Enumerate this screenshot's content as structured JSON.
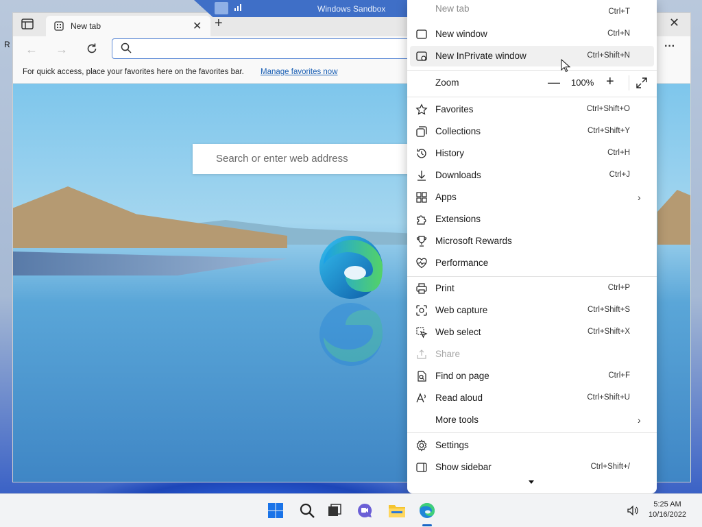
{
  "sandbox": {
    "title": "Windows Sandbox"
  },
  "desktop": {
    "stub": "R"
  },
  "browser": {
    "tab_label": "New tab",
    "favbar_message": "For quick access, place your favorites here on the favorites bar.",
    "favbar_link": "Manage favorites now",
    "page_search_placeholder": "Search or enter web address"
  },
  "menu": {
    "top_partial": {
      "label": "New tab",
      "shortcut": "Ctrl+T"
    },
    "items_a": [
      {
        "label": "New window",
        "shortcut": "Ctrl+N",
        "icon": "window-icon"
      },
      {
        "label": "New InPrivate window",
        "shortcut": "Ctrl+Shift+N",
        "icon": "inprivate-icon"
      }
    ],
    "zoom": {
      "label": "Zoom",
      "value": "100%"
    },
    "items_b": [
      {
        "label": "Favorites",
        "shortcut": "Ctrl+Shift+O",
        "icon": "star-icon"
      },
      {
        "label": "Collections",
        "shortcut": "Ctrl+Shift+Y",
        "icon": "collections-icon"
      },
      {
        "label": "History",
        "shortcut": "Ctrl+H",
        "icon": "history-icon"
      },
      {
        "label": "Downloads",
        "shortcut": "Ctrl+J",
        "icon": "download-icon"
      },
      {
        "label": "Apps",
        "shortcut": "",
        "icon": "apps-icon",
        "submenu": true
      },
      {
        "label": "Extensions",
        "shortcut": "",
        "icon": "puzzle-icon"
      },
      {
        "label": "Microsoft Rewards",
        "shortcut": "",
        "icon": "trophy-icon"
      },
      {
        "label": "Performance",
        "shortcut": "",
        "icon": "heartbeat-icon"
      }
    ],
    "items_c": [
      {
        "label": "Print",
        "shortcut": "Ctrl+P",
        "icon": "print-icon"
      },
      {
        "label": "Web capture",
        "shortcut": "Ctrl+Shift+S",
        "icon": "capture-icon"
      },
      {
        "label": "Web select",
        "shortcut": "Ctrl+Shift+X",
        "icon": "select-icon"
      },
      {
        "label": "Share",
        "shortcut": "",
        "icon": "share-icon",
        "disabled": true
      },
      {
        "label": "Find on page",
        "shortcut": "Ctrl+F",
        "icon": "find-icon"
      },
      {
        "label": "Read aloud",
        "shortcut": "Ctrl+Shift+U",
        "icon": "read-aloud-icon"
      },
      {
        "label": "More tools",
        "shortcut": "",
        "icon": "",
        "submenu": true
      }
    ],
    "items_d": [
      {
        "label": "Settings",
        "shortcut": "",
        "icon": "gear-icon"
      },
      {
        "label": "Show sidebar",
        "shortcut": "Ctrl+Shift+/",
        "icon": "sidebar-icon"
      }
    ]
  },
  "taskbar": {
    "time": "5:25 AM",
    "date": "10/16/2022"
  },
  "colors": {
    "accent": "#1a66c6",
    "sandbox_bar": "#3f6fc7"
  }
}
